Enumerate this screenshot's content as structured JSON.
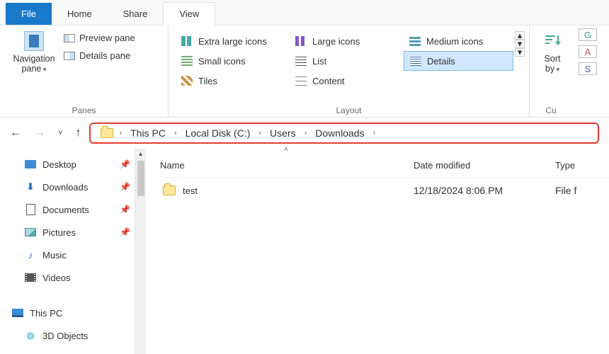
{
  "tabs": {
    "file": "File",
    "home": "Home",
    "share": "Share",
    "view": "View"
  },
  "panes_group": {
    "title": "Panes",
    "navigation": "Navigation pane",
    "preview": "Preview pane",
    "details": "Details pane"
  },
  "layout_group": {
    "title": "Layout",
    "items": {
      "xl": "Extra large icons",
      "lg": "Large icons",
      "md": "Medium icons",
      "sm": "Small icons",
      "list": "List",
      "details": "Details",
      "tiles": "Tiles",
      "content": "Content"
    }
  },
  "sort": "Sort by",
  "current_group_title": "Cu",
  "right_btn1": "G",
  "right_btn2": "A",
  "right_btn3": "S",
  "breadcrumb": {
    "seg1": "This PC",
    "seg2": "Local Disk (C:)",
    "seg3": "Users",
    "seg4": "Downloads"
  },
  "columns": {
    "name": "Name",
    "date": "Date modified",
    "type": "Type"
  },
  "rows": [
    {
      "name": "test",
      "date": "12/18/2024 8:06 PM",
      "type": "File f"
    }
  ],
  "sidebar": {
    "desktop": "Desktop",
    "downloads": "Downloads",
    "documents": "Documents",
    "pictures": "Pictures",
    "music": "Music",
    "videos": "Videos",
    "thispc": "This PC",
    "objects": "3D Objects"
  }
}
